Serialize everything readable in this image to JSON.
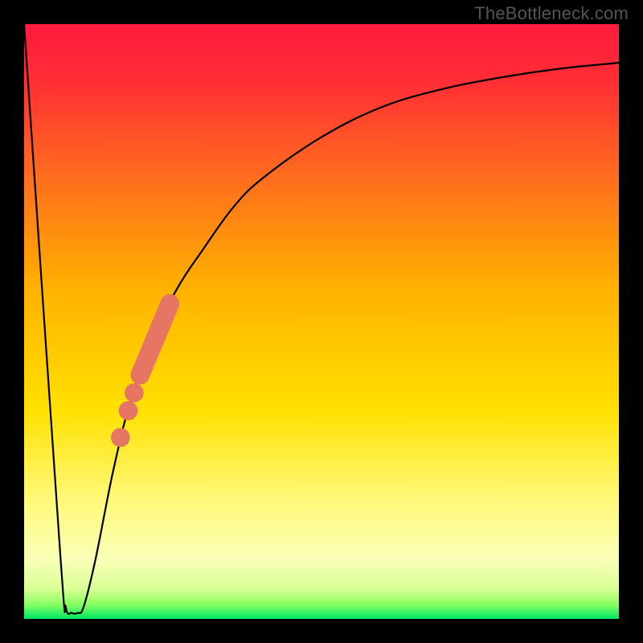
{
  "watermark": "TheBottleneck.com",
  "colors": {
    "frame": "#000000",
    "watermark_text": "#555555",
    "curve": "#000000",
    "marker": "#e77564",
    "gradient_stops": [
      {
        "offset": 0.0,
        "color": "#ff1a3f"
      },
      {
        "offset": 0.1,
        "color": "#ff2f35"
      },
      {
        "offset": 0.25,
        "color": "#ff6a1f"
      },
      {
        "offset": 0.45,
        "color": "#ffb300"
      },
      {
        "offset": 0.65,
        "color": "#ffe100"
      },
      {
        "offset": 0.8,
        "color": "#fff97a"
      },
      {
        "offset": 0.9,
        "color": "#f9ffb8"
      },
      {
        "offset": 0.95,
        "color": "#d8ff94"
      },
      {
        "offset": 0.975,
        "color": "#8cff63"
      },
      {
        "offset": 1.0,
        "color": "#00e864"
      }
    ]
  },
  "chart_data": {
    "type": "line",
    "title": "",
    "xlabel": "",
    "ylabel": "",
    "xlim": [
      0,
      100
    ],
    "ylim": [
      0,
      100
    ],
    "series": [
      {
        "name": "bottleneck-curve",
        "x": [
          0,
          6,
          7,
          8,
          9,
          10,
          12,
          15,
          18,
          22,
          26,
          30,
          35,
          40,
          50,
          60,
          70,
          80,
          90,
          100
        ],
        "y": [
          100,
          12,
          2,
          1,
          1,
          2,
          10,
          25,
          37,
          48,
          56,
          62,
          69,
          74,
          81,
          86,
          89,
          91,
          92.5,
          93.5
        ]
      }
    ],
    "markers": [
      {
        "name": "red-segment",
        "type": "segment",
        "x_start": 19.5,
        "y_start": 41,
        "x_end": 24.5,
        "y_end": 53,
        "width": 3.2
      },
      {
        "name": "red-dot-1",
        "type": "dot",
        "x": 18.5,
        "y": 38,
        "r": 1.6
      },
      {
        "name": "red-dot-2",
        "type": "dot",
        "x": 17.5,
        "y": 35,
        "r": 1.6
      },
      {
        "name": "red-dot-3",
        "type": "dot",
        "x": 16.2,
        "y": 30.5,
        "r": 1.6
      }
    ]
  }
}
